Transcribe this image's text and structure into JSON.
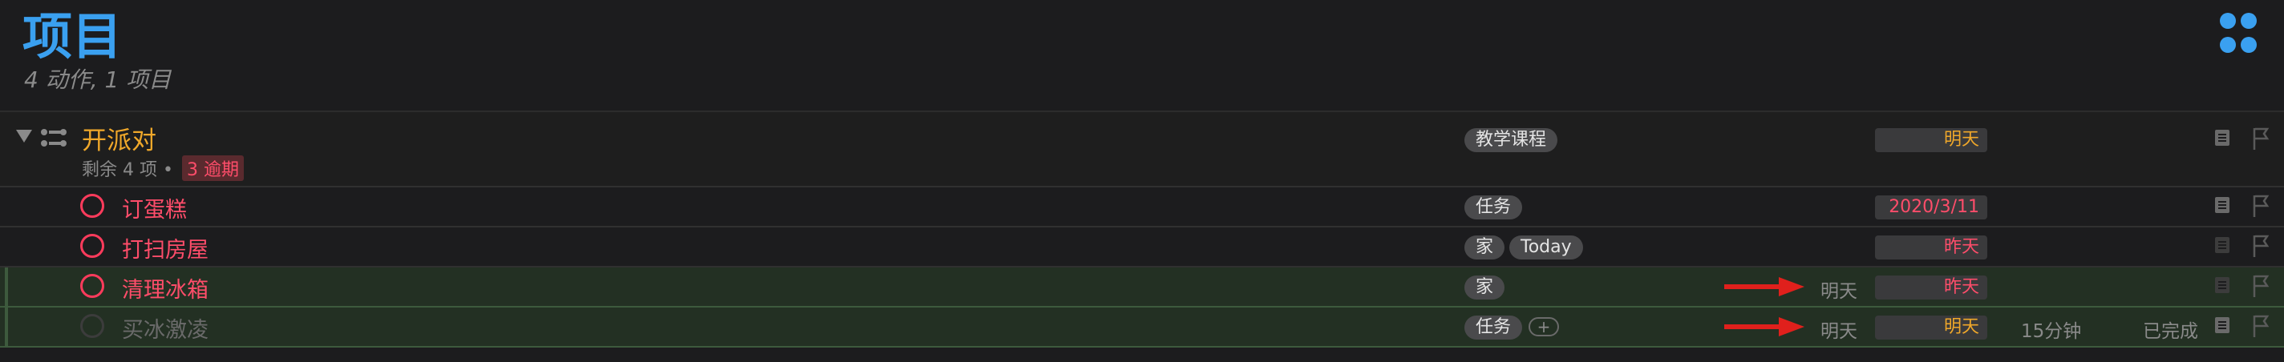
{
  "header": {
    "title": "项目",
    "subtitle": "4 动作, 1 项目"
  },
  "project": {
    "title": "开派对",
    "meta_prefix": "剩余 4 项 •",
    "overdue": "3 逾期",
    "tag": "教学课程",
    "due": "明天"
  },
  "tasks": [
    {
      "title": "订蛋糕",
      "tags": [
        "任务"
      ],
      "due": "2020/3/11",
      "due_color": "red"
    },
    {
      "title": "打扫房屋",
      "tags": [
        "家",
        "Today"
      ],
      "due": "昨天",
      "due_color": "red"
    },
    {
      "title": "清理冰箱",
      "tags": [
        "家"
      ],
      "defer": "明天",
      "due": "昨天",
      "due_color": "red"
    },
    {
      "title": "买冰激凌",
      "tags": [
        "任务"
      ],
      "add_tag": "+",
      "defer": "明天",
      "due": "明天",
      "due_color": "orange",
      "estimate": "15分钟",
      "status": "已完成"
    }
  ],
  "colors": {
    "accent": "#3aa0f0",
    "project_title": "#f0a82a",
    "overdue": "#ff4d6a",
    "arrow": "#e0201c"
  },
  "icons": [
    "app-logo-icon",
    "disclosure-triangle-icon",
    "project-sequential-icon",
    "checkbox-circle-icon",
    "note-icon",
    "flag-icon",
    "red-arrow-icon"
  ]
}
